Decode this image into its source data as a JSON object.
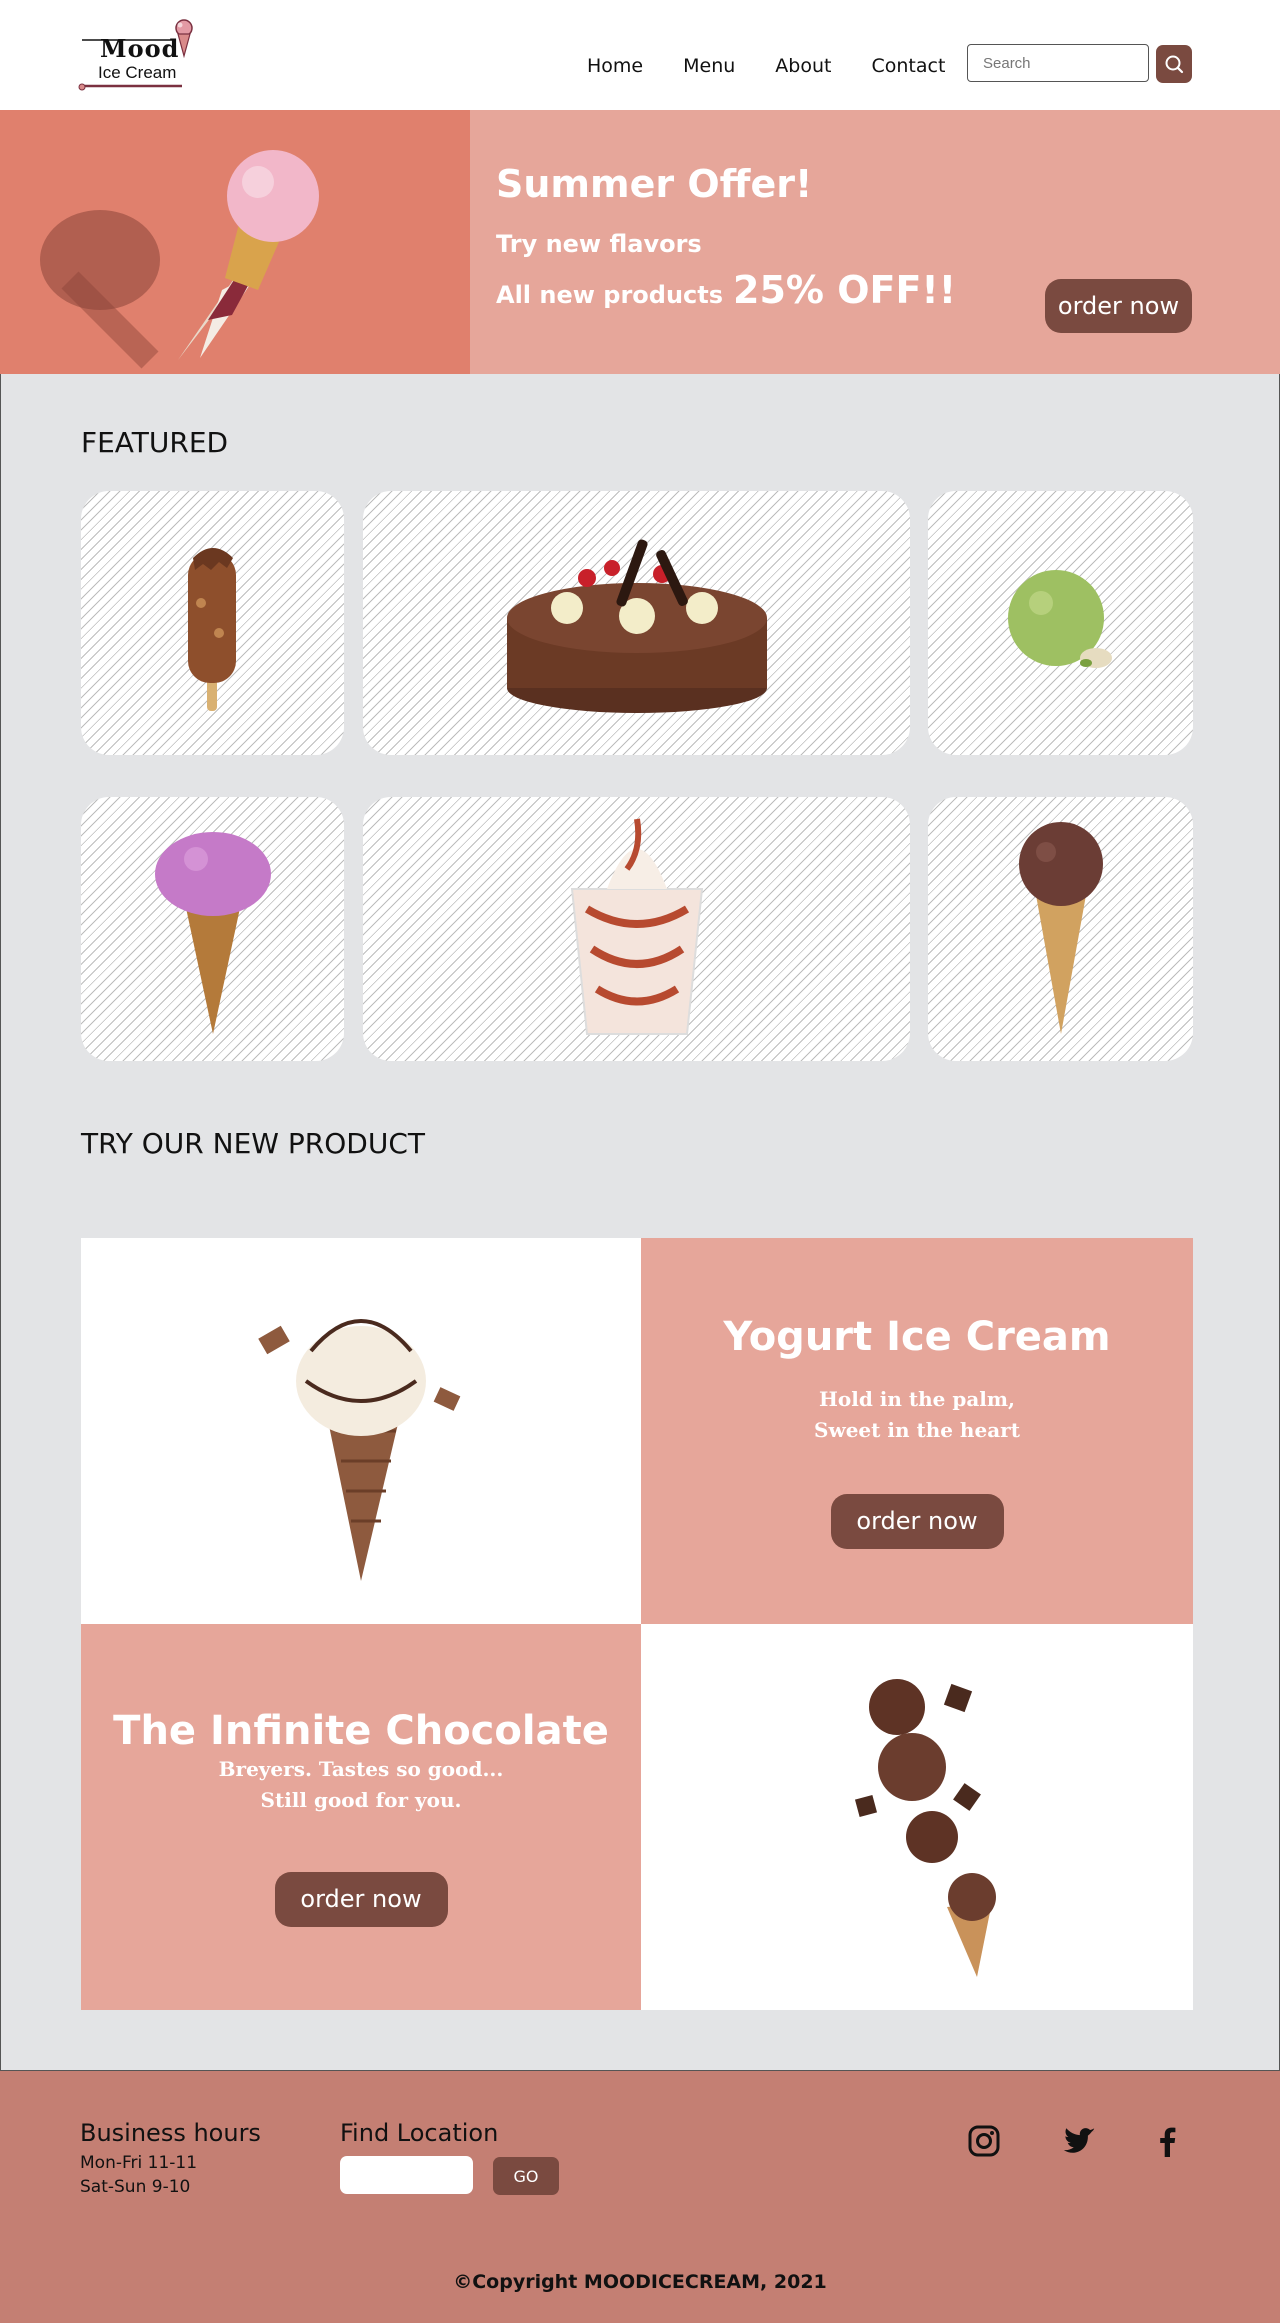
{
  "brand": {
    "logo_line1": "Mood",
    "logo_line2": "Ice Cream"
  },
  "nav": {
    "items": [
      "Home",
      "Menu",
      "About",
      "Contact"
    ]
  },
  "search": {
    "placeholder": "Search",
    "icon": "search-icon"
  },
  "hero": {
    "title": "Summer Offer!",
    "line1": "Try new flavors",
    "line2_prefix": "All new products",
    "line2_highlight": "25% OFF!!",
    "order_label": "order now"
  },
  "featured": {
    "title": "FEATURED",
    "items": [
      "chocolate-popsicle",
      "black-forest-cake",
      "pistachio-scoop",
      "berry-ice-cream-cone",
      "caramel-sundae-cup",
      "chocolate-ice-cream-cone"
    ]
  },
  "new_product": {
    "title": "TRY OUR NEW PRODUCT",
    "promo1": {
      "title": "Yogurt Ice Cream",
      "sub1": "Hold in the palm,",
      "sub2": "Sweet in the heart",
      "order_label": "order now"
    },
    "promo2": {
      "title": "The Infinite Chocolate",
      "sub1": "Breyers. Tastes so good...",
      "sub2": "Still good for you.",
      "order_label": "order now"
    }
  },
  "footer": {
    "hours_title": "Business hours",
    "hours_weekday": "Mon-Fri 11-11",
    "hours_weekend": "Sat-Sun 9-10",
    "location_title": "Find Location",
    "location_value": "",
    "go_label": "GO",
    "social": [
      "instagram-icon",
      "twitter-icon",
      "facebook-icon"
    ],
    "copyright": "©Copyright MOODICECREAM, 2021"
  },
  "colors": {
    "accent_dark": "#7a4a40",
    "pink": "#e6a69a",
    "hero_left": "#e0806d",
    "footer_bg": "#c47f73",
    "main_bg": "#e3e4e6"
  }
}
